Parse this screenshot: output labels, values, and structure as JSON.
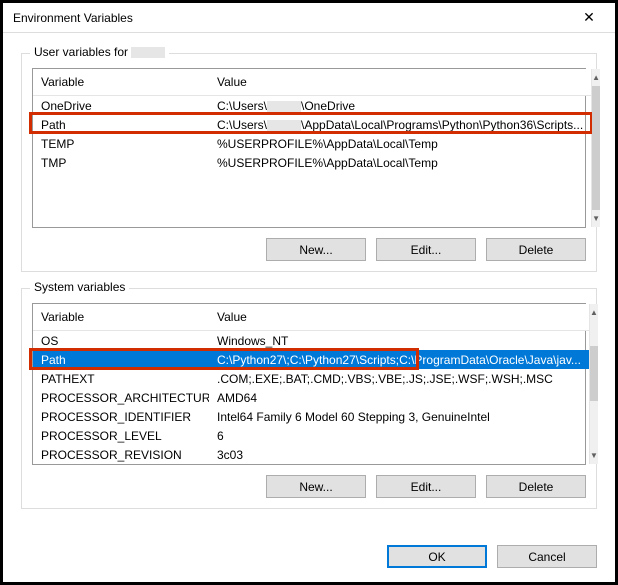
{
  "window": {
    "title": "Environment Variables"
  },
  "user_section": {
    "label_prefix": "User variables for ",
    "columns": {
      "variable": "Variable",
      "value": "Value"
    },
    "rows": [
      {
        "var": "OneDrive",
        "val_prefix": "C:\\Users\\",
        "val_suffix": "\\OneDrive"
      },
      {
        "var": "Path",
        "val_prefix": "C:\\Users\\",
        "val_suffix": "\\AppData\\Local\\Programs\\Python\\Python36\\Scripts..."
      },
      {
        "var": "TEMP",
        "val": "%USERPROFILE%\\AppData\\Local\\Temp"
      },
      {
        "var": "TMP",
        "val": "%USERPROFILE%\\AppData\\Local\\Temp"
      }
    ],
    "buttons": {
      "new": "New...",
      "edit": "Edit...",
      "delete": "Delete"
    }
  },
  "system_section": {
    "label": "System variables",
    "columns": {
      "variable": "Variable",
      "value": "Value"
    },
    "rows": [
      {
        "var": "OS",
        "val": "Windows_NT"
      },
      {
        "var": "Path",
        "val": "C:\\Python27\\;C:\\Python27\\Scripts;C:\\ProgramData\\Oracle\\Java\\jav...",
        "selected": true
      },
      {
        "var": "PATHEXT",
        "val": ".COM;.EXE;.BAT;.CMD;.VBS;.VBE;.JS;.JSE;.WSF;.WSH;.MSC"
      },
      {
        "var": "PROCESSOR_ARCHITECTURE",
        "val": "AMD64"
      },
      {
        "var": "PROCESSOR_IDENTIFIER",
        "val": "Intel64 Family 6 Model 60 Stepping 3, GenuineIntel"
      },
      {
        "var": "PROCESSOR_LEVEL",
        "val": "6"
      },
      {
        "var": "PROCESSOR_REVISION",
        "val": "3c03"
      }
    ],
    "buttons": {
      "new": "New...",
      "edit": "Edit...",
      "delete": "Delete"
    }
  },
  "footer": {
    "ok": "OK",
    "cancel": "Cancel"
  }
}
